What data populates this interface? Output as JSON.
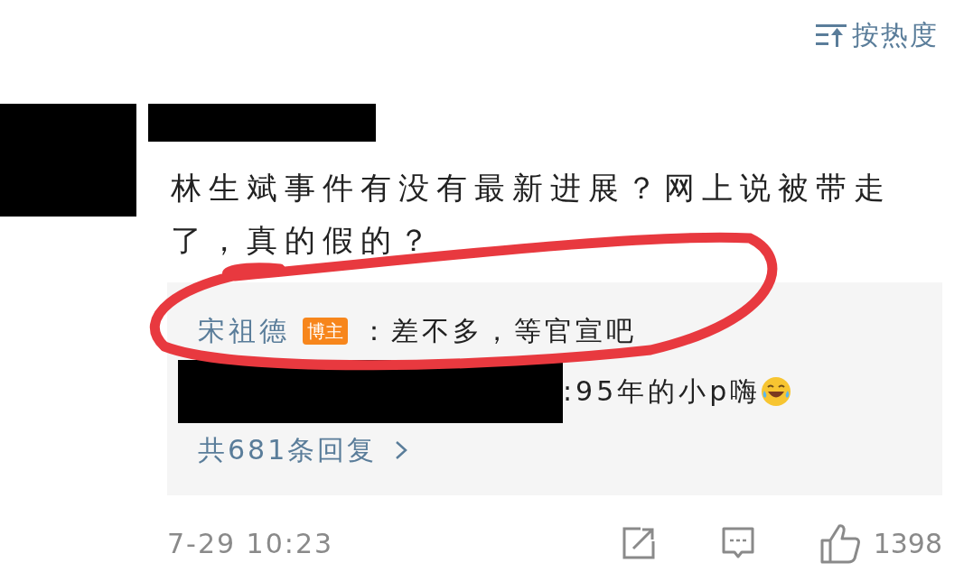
{
  "sort": {
    "label": "按热度"
  },
  "comment": {
    "text": "林生斌事件有没有最新进展？网上说被带走了，真的假的？",
    "replies": [
      {
        "kind": "named",
        "author": "宋祖德",
        "badge": "博主",
        "text": "：差不多，等官宣吧"
      },
      {
        "kind": "redacted",
        "text": ":95年的小p嗨",
        "emoji": true
      }
    ],
    "reply_count": "共681条回复",
    "time": "7-29 10:23",
    "likes": "1398"
  }
}
